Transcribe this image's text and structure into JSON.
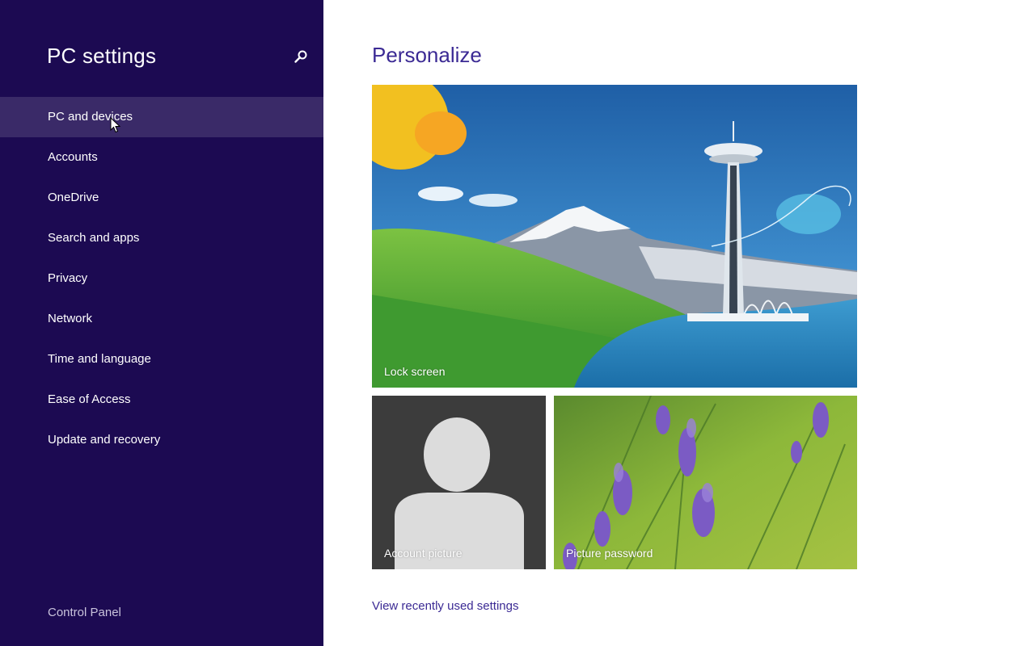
{
  "sidebar": {
    "title": "PC settings",
    "search_icon": "search-icon",
    "items": [
      {
        "label": "PC and devices",
        "selected": true
      },
      {
        "label": "Accounts"
      },
      {
        "label": "OneDrive"
      },
      {
        "label": "Search and apps"
      },
      {
        "label": "Privacy"
      },
      {
        "label": "Network"
      },
      {
        "label": "Time and language"
      },
      {
        "label": "Ease of Access"
      },
      {
        "label": "Update and recovery"
      }
    ],
    "footer_link": "Control Panel"
  },
  "main": {
    "title": "Personalize",
    "tiles": {
      "lock_screen": "Lock screen",
      "account_picture": "Account picture",
      "picture_password": "Picture password"
    },
    "recent_link": "View recently used settings"
  },
  "colors": {
    "sidebar_bg": "#1c0a52",
    "sidebar_selected_bg": "#3a2a68",
    "accent": "#3b2a94",
    "account_tile_bg": "#3c3c3c"
  }
}
